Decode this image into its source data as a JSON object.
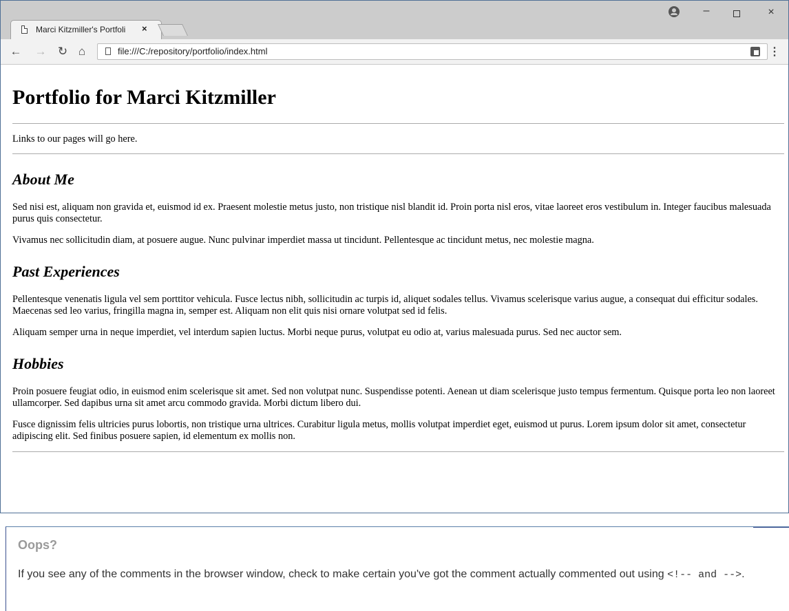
{
  "browser": {
    "tab_title": "Marci Kitzmiller's Portfoli",
    "tab_close": "×",
    "minimize": "–",
    "close": "×",
    "url": "file:///C:/repository/portfolio/index.html",
    "menu": "⋮"
  },
  "page": {
    "heading": "Portfolio for Marci Kitzmiller",
    "links_text": "Links to our pages will go here.",
    "sections": [
      {
        "title": "About Me",
        "paragraphs": [
          "Sed nisi est, aliquam non gravida et, euismod id ex. Praesent molestie metus justo, non tristique nisl blandit id. Proin porta nisl eros, vitae laoreet eros vestibulum in. Integer faucibus malesuada purus quis consectetur.",
          "Vivamus nec sollicitudin diam, at posuere augue. Nunc pulvinar imperdiet massa ut tincidunt. Pellentesque ac tincidunt metus, nec molestie magna."
        ]
      },
      {
        "title": "Past Experiences",
        "paragraphs": [
          "Pellentesque venenatis ligula vel sem porttitor vehicula. Fusce lectus nibh, sollicitudin ac turpis id, aliquet sodales tellus. Vivamus scelerisque varius augue, a consequat dui efficitur sodales. Maecenas sed leo varius, fringilla magna in, semper est. Aliquam non elit quis nisi ornare volutpat sed id felis.",
          "Aliquam semper urna in neque imperdiet, vel interdum sapien luctus. Morbi neque purus, volutpat eu odio at, varius malesuada purus. Sed nec auctor sem."
        ]
      },
      {
        "title": "Hobbies",
        "paragraphs": [
          "Proin posuere feugiat odio, in euismod enim scelerisque sit amet. Sed non volutpat nunc. Suspendisse potenti. Aenean ut diam scelerisque justo tempus fermentum. Quisque porta leo non laoreet ullamcorper. Sed dapibus urna sit amet arcu commodo gravida. Morbi dictum libero dui.",
          "Fusce dignissim felis ultricies purus lobortis, non tristique urna ultrices. Curabitur ligula metus, mollis volutpat imperdiet eget, euismod ut purus. Lorem ipsum dolor sit amet, consectetur adipiscing elit. Sed finibus posuere sapien, id elementum ex mollis non."
        ]
      }
    ]
  },
  "callout": {
    "title": "Oops?",
    "body_before": "If you see any of the comments in the browser window, check to make certain you've got the comment actually commented out using ",
    "code_open": "<!-- and -->",
    "body_after": "."
  }
}
